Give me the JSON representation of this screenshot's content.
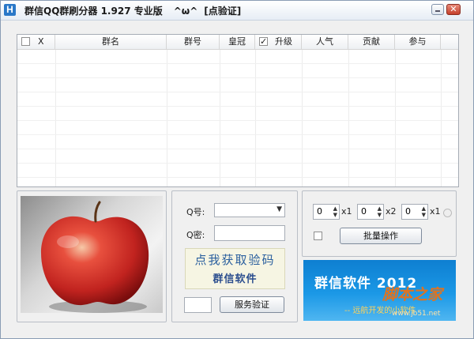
{
  "window": {
    "icon_glyph": "H",
    "title": "群信QQ群刷分器 1.927 专业版",
    "emote": "^ω^",
    "verify_link": "[点验证]",
    "close_glyph": "✕"
  },
  "list": {
    "columns": [
      "X",
      "群名",
      "群号",
      "皇冠",
      "升级",
      "人气",
      "贡献",
      "参与"
    ],
    "select_all_checked": false,
    "upgrade_checked": true
  },
  "login": {
    "qq_label": "Q号:",
    "qq_value": "",
    "pwd_label": "Q密:",
    "pwd_value": "",
    "captcha_line1": "点我获取验码",
    "captcha_line2": "群信软件",
    "captcha_input": "",
    "verify_button": "服务验证"
  },
  "batch": {
    "spinners": [
      {
        "value": "0",
        "mult": "x1"
      },
      {
        "value": "0",
        "mult": "x2"
      },
      {
        "value": "0",
        "mult": "x1"
      }
    ],
    "batch_button": "批量操作"
  },
  "banner": {
    "title": "群信软件 2012",
    "watermark": "脚本之家",
    "subtitle": "-- 远航开发的小软件",
    "url": "www.jb51.net"
  },
  "colors": {
    "banner_blue": "#1b98e6",
    "watermark_orange": "#e0731f",
    "close_red": "#c43f2b"
  }
}
